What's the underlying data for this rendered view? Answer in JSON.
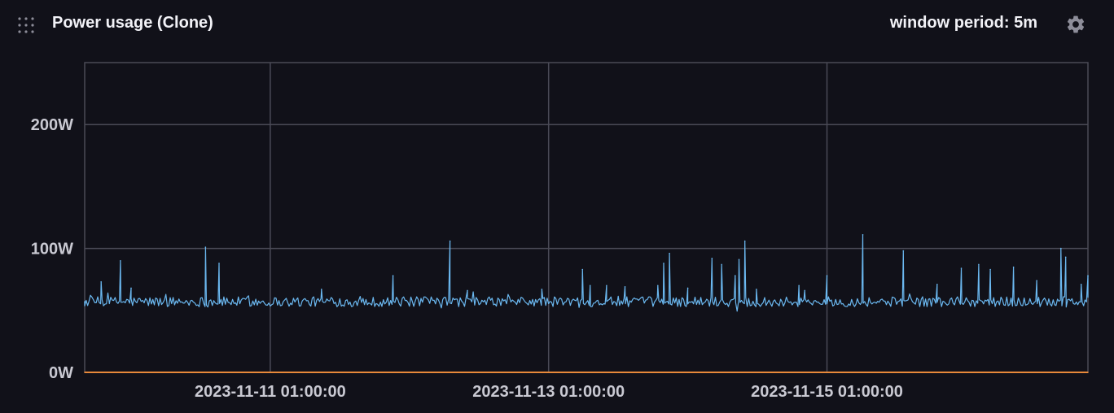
{
  "panel": {
    "title": "Power usage (Clone)",
    "window_period": "window period: 5m",
    "icons": {
      "drag": "drag-handle-icon",
      "settings": "gear-icon"
    }
  },
  "colors": {
    "background": "#111119",
    "grid": "#4a4a56",
    "series_power": "#6bb8f0",
    "series_baseline": "#e8893a",
    "tick_text": "#c9c9d2"
  },
  "chart_data": {
    "type": "line",
    "title": "Power usage (Clone)",
    "xlabel": "",
    "ylabel": "",
    "ylim": [
      0,
      250
    ],
    "y_ticks": [
      {
        "value": 0,
        "label": "0W"
      },
      {
        "value": 100,
        "label": "100W"
      },
      {
        "value": 200,
        "label": "200W"
      }
    ],
    "xlim": [
      "2023-11-09 17:00:00",
      "2023-11-16 22:00:00"
    ],
    "x_ticks": [
      {
        "value": "2023-11-11 01:00:00",
        "label": "2023-11-11 01:00:00"
      },
      {
        "value": "2023-11-13 01:00:00",
        "label": "2023-11-13 01:00:00"
      },
      {
        "value": "2023-11-15 01:00:00",
        "label": "2023-11-15 01:00:00"
      }
    ],
    "grid": true,
    "legend": "none",
    "series": [
      {
        "color": "#6bb8f0",
        "baseline": 57,
        "noise_amplitude": 4,
        "points": [
          [
            "2023-11-09 17:00:00",
            57
          ],
          [
            "2023-11-09 19:50:00",
            73
          ],
          [
            "2023-11-09 23:10:00",
            90
          ],
          [
            "2023-11-10 01:00:00",
            68
          ],
          [
            "2023-11-10 13:50:00",
            101
          ],
          [
            "2023-11-10 16:10:00",
            88
          ],
          [
            "2023-11-11 09:50:00",
            67
          ],
          [
            "2023-11-11 22:10:00",
            78
          ],
          [
            "2023-11-12 08:00:00",
            106
          ],
          [
            "2023-11-12 11:00:00",
            66
          ],
          [
            "2023-11-12 23:50:00",
            67
          ],
          [
            "2023-11-13 06:50:00",
            83
          ],
          [
            "2023-11-13 08:10:00",
            70
          ],
          [
            "2023-11-13 11:00:00",
            70
          ],
          [
            "2023-11-13 14:10:00",
            69
          ],
          [
            "2023-11-13 19:50:00",
            70
          ],
          [
            "2023-11-13 20:50:00",
            88
          ],
          [
            "2023-11-13 21:50:00",
            96
          ],
          [
            "2023-11-14 01:00:00",
            68
          ],
          [
            "2023-11-14 05:10:00",
            92
          ],
          [
            "2023-11-14 06:50:00",
            87
          ],
          [
            "2023-11-14 09:10:00",
            78
          ],
          [
            "2023-11-14 09:50:00",
            91
          ],
          [
            "2023-11-14 10:50:00",
            106
          ],
          [
            "2023-11-14 12:50:00",
            67
          ],
          [
            "2023-11-14 20:10:00",
            70
          ],
          [
            "2023-11-14 21:10:00",
            66
          ],
          [
            "2023-11-15 01:00:00",
            78
          ],
          [
            "2023-11-15 07:10:00",
            111
          ],
          [
            "2023-11-15 14:10:00",
            98
          ],
          [
            "2023-11-15 20:00:00",
            71
          ],
          [
            "2023-11-16 00:10:00",
            84
          ],
          [
            "2023-11-16 03:10:00",
            87
          ],
          [
            "2023-11-16 05:10:00",
            83
          ],
          [
            "2023-11-16 09:10:00",
            85
          ],
          [
            "2023-11-16 13:10:00",
            74
          ],
          [
            "2023-11-16 17:20:00",
            100
          ],
          [
            "2023-11-16 18:10:00",
            93
          ],
          [
            "2023-11-16 20:50:00",
            71
          ],
          [
            "2023-11-16 22:00:00",
            78
          ]
        ]
      },
      {
        "color": "#e8893a",
        "points": [
          [
            "2023-11-09 17:00:00",
            0
          ],
          [
            "2023-11-16 22:00:00",
            0
          ]
        ]
      }
    ]
  }
}
